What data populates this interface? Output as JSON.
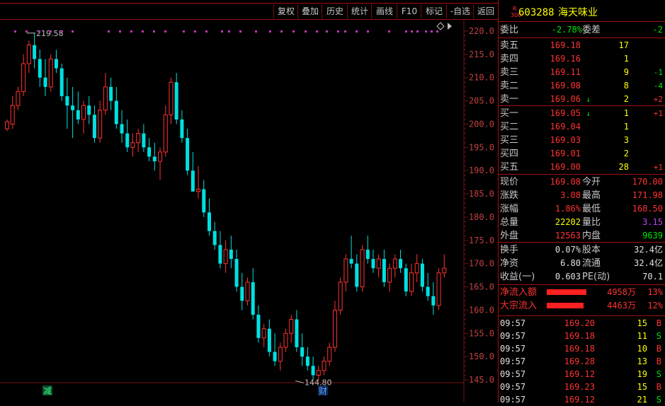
{
  "toolbar": {
    "buttons": [
      "复权",
      "叠加",
      "历史",
      "统计",
      "画线",
      "F10",
      "标记",
      "-自选",
      "返回"
    ]
  },
  "stock": {
    "badge_top": "R",
    "badge_bottom": "300",
    "code": "603288",
    "name": "海天味业"
  },
  "commission": {
    "ratio_label": "委比",
    "ratio_value": "-2.78%",
    "diff_label": "委差",
    "diff_value": "-2"
  },
  "asks": [
    {
      "label": "卖五",
      "price": "169.18",
      "vol": "17",
      "chg": ""
    },
    {
      "label": "卖四",
      "price": "169.16",
      "vol": "1",
      "chg": ""
    },
    {
      "label": "卖三",
      "price": "169.11",
      "vol": "9",
      "chg": "-1"
    },
    {
      "label": "卖二",
      "price": "169.08",
      "vol": "8",
      "chg": "-4"
    },
    {
      "label": "卖一",
      "price": "169.06",
      "vol": "2",
      "chg": "+2",
      "arrow": "↓"
    }
  ],
  "bids": [
    {
      "label": "买一",
      "price": "169.05",
      "vol": "1",
      "chg": "+1",
      "arrow": "↓"
    },
    {
      "label": "买二",
      "price": "169.04",
      "vol": "1",
      "chg": ""
    },
    {
      "label": "买三",
      "price": "169.03",
      "vol": "3",
      "chg": ""
    },
    {
      "label": "买四",
      "price": "169.01",
      "vol": "2",
      "chg": ""
    },
    {
      "label": "买五",
      "price": "169.00",
      "vol": "28",
      "chg": "+1"
    }
  ],
  "stats": [
    {
      "l1": "现价",
      "v1": "169.08",
      "c1": "red",
      "l2": "今开",
      "v2": "170.00",
      "c2": "red"
    },
    {
      "l1": "涨跌",
      "v1": "3.08",
      "c1": "red",
      "l2": "最高",
      "v2": "171.98",
      "c2": "red"
    },
    {
      "l1": "涨幅",
      "v1": "1.86%",
      "c1": "red",
      "l2": "最低",
      "v2": "168.50",
      "c2": "red"
    },
    {
      "l1": "总量",
      "v1": "22202",
      "c1": "yellow",
      "l2": "量比",
      "v2": "3.15",
      "c2": "purple"
    },
    {
      "l1": "外盘",
      "v1": "12563",
      "c1": "red",
      "l2": "内盘",
      "v2": "9639",
      "c2": "green"
    }
  ],
  "finance": [
    {
      "l1": "换手",
      "v1": "0.07%",
      "l2": "股本",
      "v2": "32.4亿"
    },
    {
      "l1": "净资",
      "v1": "6.80",
      "l2": "流通",
      "v2": "32.4亿"
    },
    {
      "l1": "收益(一)",
      "v1": "0.603",
      "l2": "PE(动)",
      "v2": "70.1"
    }
  ],
  "flows": [
    {
      "label": "净流入额",
      "amount": "4958万",
      "pct": "13%",
      "bar": 0.78
    },
    {
      "label": "大宗流入",
      "amount": "4463万",
      "pct": "12%",
      "bar": 0.72
    }
  ],
  "trades": [
    {
      "time": "09:57",
      "price": "169.20",
      "vol": "15",
      "side": "B"
    },
    {
      "time": "09:57",
      "price": "169.18",
      "vol": "11",
      "side": "S"
    },
    {
      "time": "09:57",
      "price": "169.18",
      "vol": "10",
      "side": "B"
    },
    {
      "time": "09:57",
      "price": "169.28",
      "vol": "13",
      "side": "B"
    },
    {
      "time": "09:57",
      "price": "169.12",
      "vol": "19",
      "side": "S"
    },
    {
      "time": "09:57",
      "price": "169.23",
      "vol": "15",
      "side": "B"
    },
    {
      "time": "09:57",
      "price": "169.12",
      "vol": "21",
      "side": "S"
    }
  ],
  "chart": {
    "y_ticks": [
      "220.0",
      "215.0",
      "210.0",
      "205.0",
      "200.0",
      "195.0",
      "190.0",
      "185.0",
      "180.0",
      "175.0",
      "170.0",
      "165.0",
      "160.0",
      "155.0",
      "150.0",
      "145.0"
    ],
    "high_label": "219.58",
    "low_label": "144.80",
    "marker_jian": "减",
    "marker_cai": "财",
    "colors": {
      "up": "#ff3232",
      "down": "#00e0e0",
      "grid": "#7a1010",
      "marker": "#c030c0"
    }
  },
  "chart_data": {
    "type": "candlestick",
    "ylim": [
      142,
      222
    ],
    "candles": [
      [
        199,
        201,
        198.5,
        200.5
      ],
      [
        200,
        206,
        199,
        204
      ],
      [
        204,
        208,
        203,
        207
      ],
      [
        207,
        215,
        206,
        213
      ],
      [
        213,
        218,
        211,
        217
      ],
      [
        217,
        219.58,
        212,
        214
      ],
      [
        214,
        216,
        208,
        210
      ],
      [
        210,
        214,
        206,
        208
      ],
      [
        208,
        215,
        207,
        214
      ],
      [
        214,
        216,
        211,
        212
      ],
      [
        212,
        213,
        205,
        206
      ],
      [
        206,
        210,
        199,
        204
      ],
      [
        204,
        208,
        197,
        203
      ],
      [
        203,
        207,
        200,
        201
      ],
      [
        201,
        205,
        198,
        204
      ],
      [
        204,
        206,
        200,
        202
      ],
      [
        202,
        204,
        196,
        197
      ],
      [
        197,
        205,
        196,
        203
      ],
      [
        203,
        211,
        202,
        208
      ],
      [
        208,
        210,
        203,
        205
      ],
      [
        205,
        208,
        199,
        200
      ],
      [
        200,
        203,
        196,
        198
      ],
      [
        198,
        201,
        194,
        195
      ],
      [
        195,
        198,
        193,
        196
      ],
      [
        196,
        199,
        194,
        198
      ],
      [
        198,
        200,
        194,
        195
      ],
      [
        195,
        197,
        192,
        193
      ],
      [
        193,
        196,
        190,
        192
      ],
      [
        192,
        195,
        188,
        194
      ],
      [
        194,
        204,
        193,
        202
      ],
      [
        202,
        210,
        200,
        209
      ],
      [
        209,
        211,
        200,
        201
      ],
      [
        201,
        203,
        196,
        197
      ],
      [
        197,
        199,
        189,
        190
      ],
      [
        190,
        194,
        186,
        185.5
      ],
      [
        185.5,
        191,
        184,
        186
      ],
      [
        186,
        188,
        180,
        181
      ],
      [
        181,
        184,
        176,
        177
      ],
      [
        177,
        179,
        173,
        174
      ],
      [
        174,
        177,
        169,
        170
      ],
      [
        170,
        175,
        168,
        173
      ],
      [
        173,
        176,
        169,
        171
      ],
      [
        171,
        173,
        164,
        165
      ],
      [
        165,
        168,
        160,
        162
      ],
      [
        162,
        167,
        161,
        166
      ],
      [
        166,
        169,
        158,
        159
      ],
      [
        159,
        161,
        153,
        154
      ],
      [
        154,
        157,
        152,
        156
      ],
      [
        156,
        158,
        150,
        151
      ],
      [
        151,
        155,
        148,
        149
      ],
      [
        149,
        153,
        147,
        152
      ],
      [
        152,
        156,
        151,
        155
      ],
      [
        155,
        159,
        153,
        158
      ],
      [
        158,
        160,
        151,
        152
      ],
      [
        152,
        155,
        148,
        150
      ],
      [
        150,
        152,
        147,
        148
      ],
      [
        148,
        150,
        145,
        146
      ],
      [
        146,
        148,
        144.8,
        147
      ],
      [
        147,
        150,
        146,
        149
      ],
      [
        149,
        153,
        148,
        152
      ],
      [
        152,
        162,
        151,
        160
      ],
      [
        160,
        167,
        159,
        166
      ],
      [
        166,
        172,
        164,
        171
      ],
      [
        171,
        176,
        169,
        170
      ],
      [
        170,
        172,
        164,
        165
      ],
      [
        165,
        174,
        164,
        173
      ],
      [
        173,
        176,
        170,
        171
      ],
      [
        171,
        173,
        168,
        169
      ],
      [
        169,
        172,
        167,
        171
      ],
      [
        171,
        173,
        165,
        166
      ],
      [
        166,
        170,
        164,
        169
      ],
      [
        169,
        172,
        167,
        171
      ],
      [
        171,
        173,
        168,
        169
      ],
      [
        169,
        170,
        163,
        164
      ],
      [
        164,
        170,
        163,
        168
      ],
      [
        168,
        172,
        166,
        170
      ],
      [
        170,
        171,
        164,
        165
      ],
      [
        165,
        168,
        162,
        163
      ],
      [
        163,
        166,
        159,
        161
      ],
      [
        161,
        169,
        160,
        168
      ],
      [
        168,
        172,
        167,
        169
      ]
    ]
  }
}
